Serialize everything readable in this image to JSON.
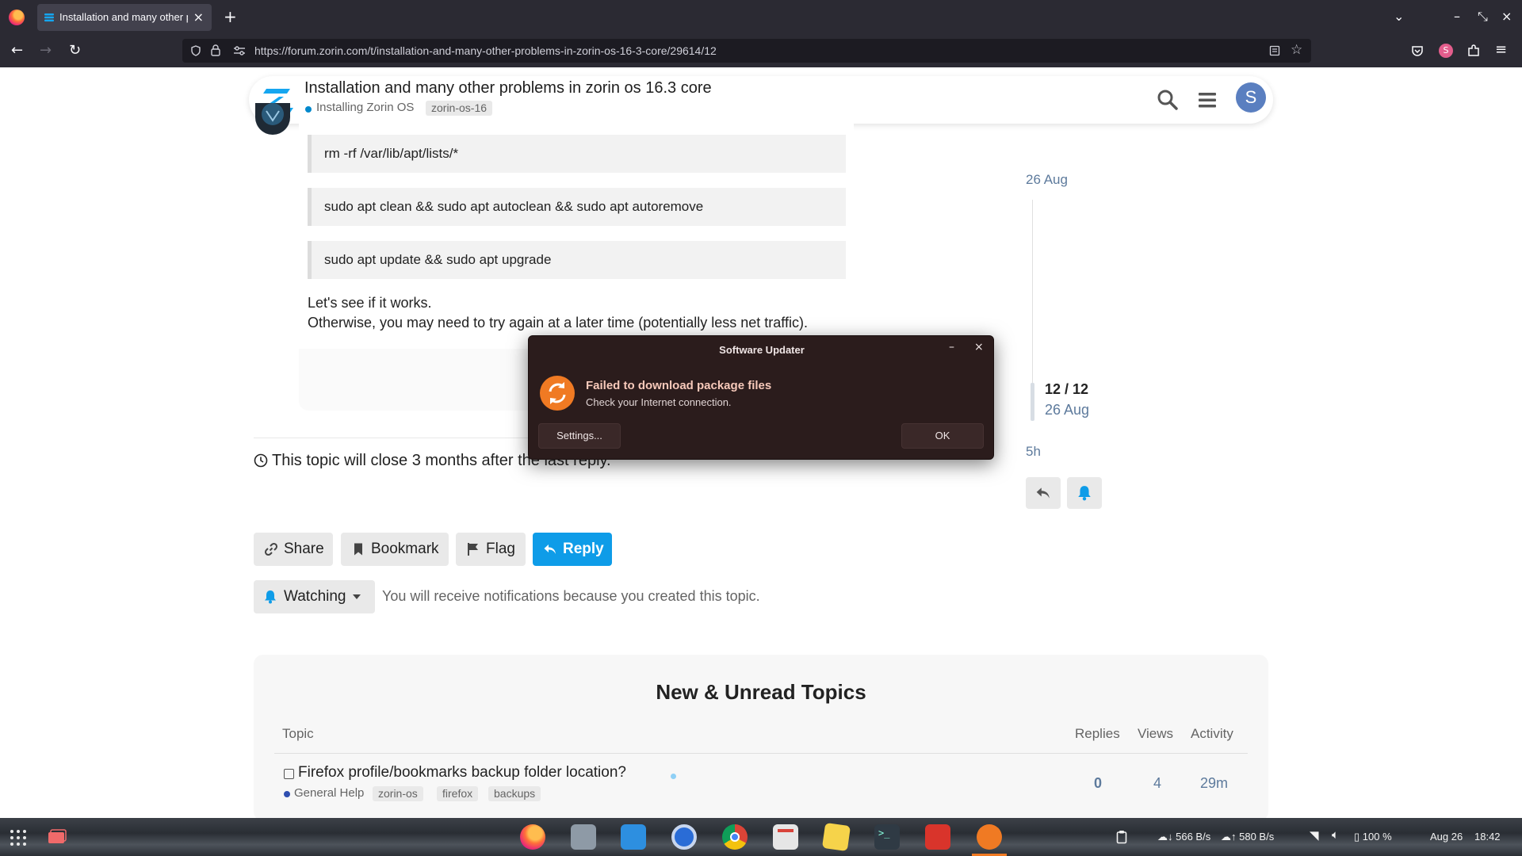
{
  "browser": {
    "tab_title": "Installation and many other problems in zorin os 16.3 core",
    "tab_close": "×",
    "new_tab": "+",
    "url": "https://forum.zorin.com/t/installation-and-many-other-problems-in-zorin-os-16-3-core/29614/12"
  },
  "header": {
    "topic_title": "Installation and many other problems in zorin os 16.3 core",
    "category": "Installing Zorin OS",
    "tag": "zorin-os-16",
    "avatar_letter": "S"
  },
  "post": {
    "code_lines": [
      "rm -rf /var/lib/apt/lists/*",
      "sudo apt clean && sudo apt autoclean && sudo apt autoremove",
      "sudo apt update && sudo apt upgrade"
    ],
    "paragraph_1": "Let's see if it works.",
    "paragraph_2": "Otherwise, you may need to try again at a later time (potentially less net traffic)."
  },
  "topic_footer": {
    "close_note": "This topic will close 3 months after the last reply.",
    "share_label": "Share",
    "bookmark_label": "Bookmark",
    "flag_label": "Flag",
    "reply_label": "Reply",
    "watching_label": "Watching",
    "watching_note": "You will receive notifications because you created this topic."
  },
  "timeline": {
    "top_date": "26 Aug",
    "counter": "12 / 12",
    "current_date": "26 Aug",
    "last_activity": "5h"
  },
  "suggested": {
    "title": "New & Unread Topics",
    "columns": {
      "topic": "Topic",
      "replies": "Replies",
      "views": "Views",
      "activity": "Activity"
    },
    "rows": [
      {
        "title": "Firefox profile/bookmarks backup folder location?",
        "category": "General Help",
        "tags": [
          "zorin-os",
          "firefox",
          "backups"
        ],
        "replies": "0",
        "views": "4",
        "activity": "29m"
      }
    ]
  },
  "dialog": {
    "title": "Software Updater",
    "minimize": "–",
    "close": "×",
    "heading": "Failed to download package files",
    "message": "Check your Internet connection.",
    "settings_label": "Settings...",
    "ok_label": "OK"
  },
  "taskbar": {
    "net_down": "566 B/s",
    "net_up": "580 B/s",
    "battery": "100 %",
    "date": "Aug 26",
    "time": "18:42"
  },
  "colors": {
    "accent_blue": "#0e9ce8",
    "updater_orange": "#f07a23",
    "browser_chrome": "#2b2a33"
  }
}
